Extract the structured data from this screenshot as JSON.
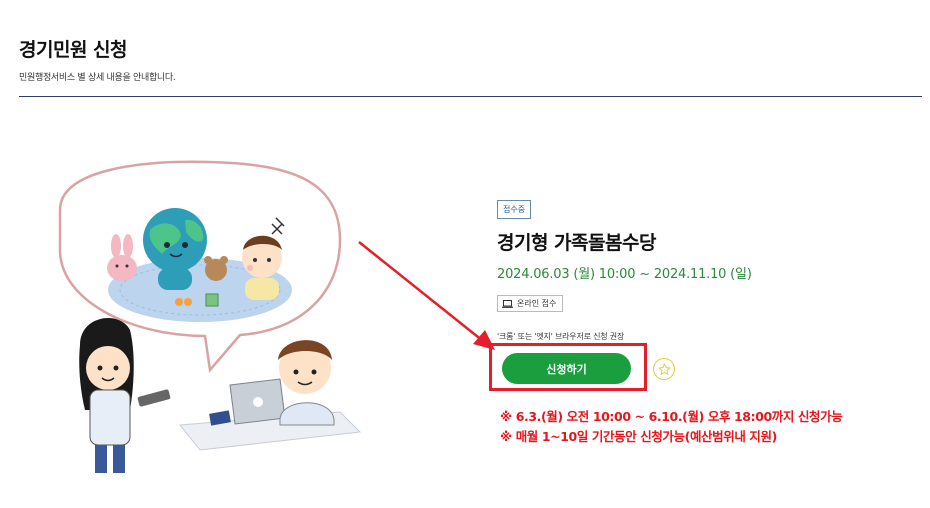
{
  "header": {
    "title": "경기민원 신청",
    "subtitle": "민원행정서비스 별 상세 내용을 안내합니다."
  },
  "service": {
    "status_badge": "접수중",
    "title": "경기형 가족돌봄수당",
    "period": "2024.06.03 (월) 10:00 ~ 2024.11.10 (일)",
    "online_tag": "온라인 접수",
    "online_icon": "laptop-icon",
    "browser_note": "'크롬' 또는 '엣지' 브라우저로 신청 권장",
    "apply_label": "신청하기",
    "favorite_icon": "star-icon",
    "notices": [
      "※ 6.3.(월) 오전 10:00 ~ 6.10.(월) 오후 18:00까지 신청가능",
      "※ 매월 1~10일 기간동안 신청가능(예산범위내 지원)"
    ]
  },
  "colors": {
    "accent_green": "#1a9e3e",
    "period_green": "#2a8a3a",
    "highlight_red": "#e41e2a",
    "notice_red": "#e8151c",
    "rule_navy": "#2f3b6b",
    "star_yellow": "#e8c840"
  }
}
